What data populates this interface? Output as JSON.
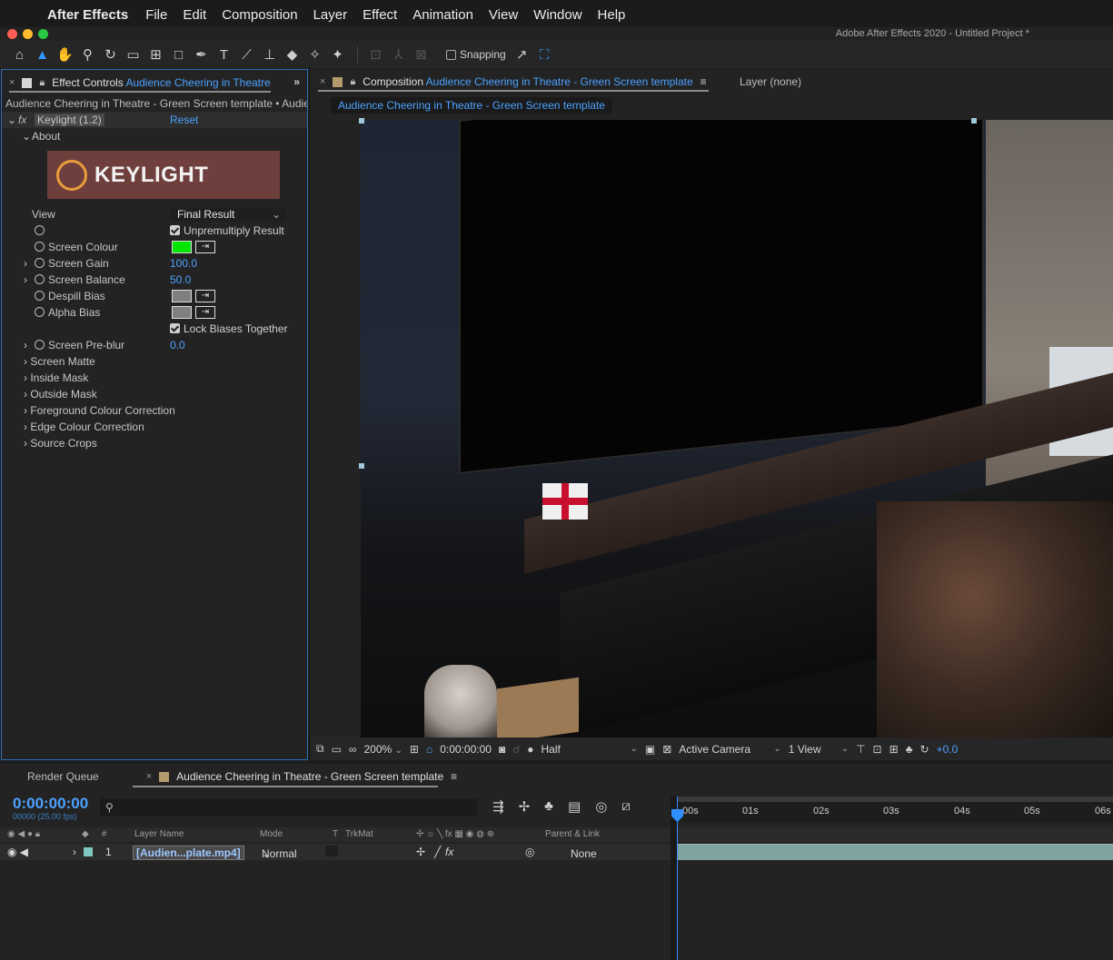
{
  "menubar": {
    "apple": "",
    "app_name": "After Effects",
    "items": [
      "File",
      "Edit",
      "Composition",
      "Layer",
      "Effect",
      "Animation",
      "View",
      "Window",
      "Help"
    ]
  },
  "window_title": "Adobe After Effects 2020 - Untitled Project *",
  "toolbar": {
    "snapping_label": "Snapping"
  },
  "effect_controls": {
    "tab_prefix": "Effect Controls",
    "tab_layer": "Audience Cheering in Theatre",
    "more": "»",
    "path": "Audience Cheering in Theatre - Green Screen template • Audienc",
    "effect_name": "Keylight (1.2)",
    "reset_label": "Reset",
    "about_label": "About",
    "logo_text": "KEYLIGHT",
    "view_label": "View",
    "view_value": "Final Result",
    "unpremultiply_label": "Unpremultiply Result",
    "screen_colour_label": "Screen Colour",
    "screen_colour": "#00e600",
    "screen_gain_label": "Screen Gain",
    "screen_gain_value": "100.0",
    "screen_balance_label": "Screen Balance",
    "screen_balance_value": "50.0",
    "despill_bias_label": "Despill Bias",
    "alpha_bias_label": "Alpha Bias",
    "bias_colour": "#808080",
    "lock_biases_label": "Lock Biases Together",
    "preblur_label": "Screen Pre-blur",
    "preblur_value": "0.0",
    "groups": [
      "Screen Matte",
      "Inside Mask",
      "Outside Mask",
      "Foreground Colour Correction",
      "Edge Colour Correction",
      "Source Crops"
    ]
  },
  "composition": {
    "tab_prefix": "Composition",
    "tab_name": "Audience Cheering in Theatre - Green Screen template",
    "layer_label": "Layer (none)",
    "sub_tab": "Audience Cheering in Theatre - Green Screen template",
    "footer": {
      "zoom": "200%",
      "timecode": "0:00:00:00",
      "resolution": "Half",
      "camera": "Active Camera",
      "views": "1 View",
      "exposure": "+0.0"
    }
  },
  "timeline": {
    "render_queue": "Render Queue",
    "comp_tab": "Audience Cheering in Theatre - Green Screen template",
    "time": "0:00:00:00",
    "frames": "00000 (25.00 fps)",
    "search_placeholder": "",
    "columns": {
      "num": "#",
      "layer_name": "Layer Name",
      "mode": "Mode",
      "t": "T",
      "trkmat": "TrkMat",
      "parent": "Parent & Link"
    },
    "layer": {
      "index": "1",
      "name": "[Audien...plate.mp4]",
      "mode": "Normal",
      "parent": "None"
    },
    "ruler_ticks": [
      "00s",
      "01s",
      "02s",
      "03s",
      "04s",
      "05s",
      "06s"
    ]
  }
}
